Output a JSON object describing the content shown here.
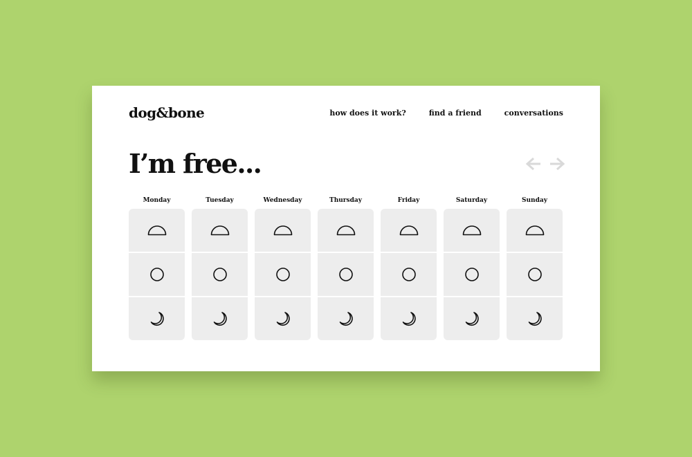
{
  "app": {
    "logo": "dog&bone"
  },
  "nav": [
    {
      "label": "how does it work?"
    },
    {
      "label": "find a friend"
    },
    {
      "label": "conversations"
    }
  ],
  "page": {
    "title": "I’m free..."
  },
  "pager": {
    "prev_icon": "arrow-left-icon",
    "next_icon": "arrow-right-icon",
    "color": "#d9d9d9"
  },
  "days": [
    {
      "label": "Monday"
    },
    {
      "label": "Tuesday"
    },
    {
      "label": "Wednesday"
    },
    {
      "label": "Thursday"
    },
    {
      "label": "Friday"
    },
    {
      "label": "Saturday"
    },
    {
      "label": "Sunday"
    }
  ],
  "slots": [
    {
      "name": "morning",
      "icon": "half-sun-icon"
    },
    {
      "name": "afternoon",
      "icon": "circle-sun-icon"
    },
    {
      "name": "evening",
      "icon": "crescent-moon-icon"
    }
  ],
  "colors": {
    "background": "#aed36d",
    "card": "#ffffff",
    "slot": "#ededed",
    "text": "#111111"
  }
}
